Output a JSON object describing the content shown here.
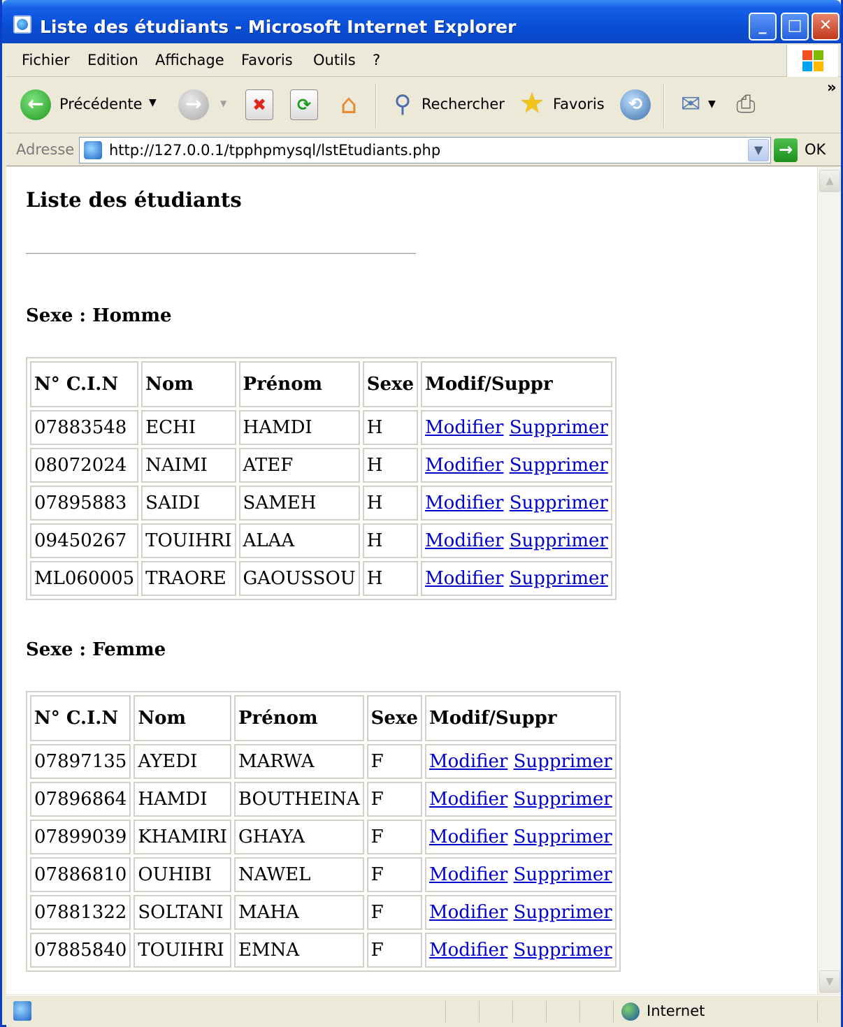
{
  "window": {
    "title": "Liste des étudiants - Microsoft Internet Explorer",
    "buttons": {
      "minimize": "_",
      "maximize": "□",
      "close": "✕"
    }
  },
  "menu": [
    "Fichier",
    "Edition",
    "Affichage",
    "Favoris",
    "Outils",
    "?"
  ],
  "toolbar": {
    "back_label": "Précédente",
    "search_label": "Rechercher",
    "favorites_label": "Favoris",
    "overflow": "»"
  },
  "address": {
    "label": "Adresse",
    "url": "http://127.0.0.1/tpphpmysql/lstEtudiants.php",
    "go_label": "OK"
  },
  "page": {
    "title": "Liste des étudiants",
    "columns": [
      "N° C.I.N",
      "Nom",
      "Prénom",
      "Sexe",
      "Modif/Suppr"
    ],
    "link_modify": "Modifier",
    "link_delete": "Supprimer",
    "sections": [
      {
        "title": "Sexe : Homme",
        "rows": [
          [
            "07883548",
            "ECHI",
            "HAMDI",
            "H"
          ],
          [
            "08072024",
            "NAIMI",
            "ATEF",
            "H"
          ],
          [
            "07895883",
            "SAIDI",
            "SAMEH",
            "H"
          ],
          [
            "09450267",
            "TOUIHRI",
            "ALAA",
            "H"
          ],
          [
            "ML060005",
            "TRAORE",
            "GAOUSSOU",
            "H"
          ]
        ]
      },
      {
        "title": "Sexe : Femme",
        "rows": [
          [
            "07897135",
            "AYEDI",
            "MARWA",
            "F"
          ],
          [
            "07896864",
            "HAMDI",
            "BOUTHEINA",
            "F"
          ],
          [
            "07899039",
            "KHAMIRI",
            "GHAYA",
            "F"
          ],
          [
            "07886810",
            "OUHIBI",
            "NAWEL",
            "F"
          ],
          [
            "07881322",
            "SOLTANI",
            "MAHA",
            "F"
          ],
          [
            "07885840",
            "TOUIHRI",
            "EMNA",
            "F"
          ]
        ]
      }
    ]
  },
  "status": {
    "zone": "Internet"
  }
}
